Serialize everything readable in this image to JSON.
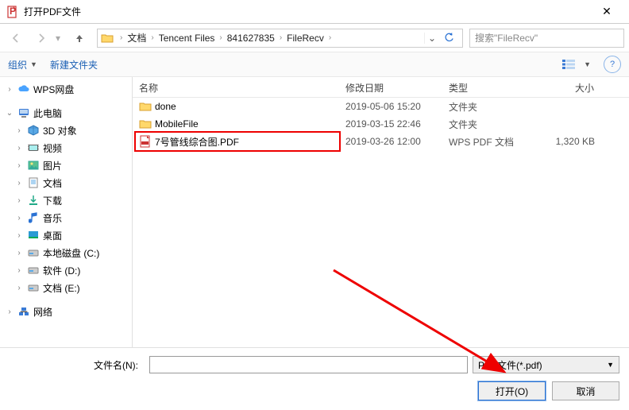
{
  "title": "打开PDF文件",
  "breadcrumbs": [
    "文档",
    "Tencent Files",
    "841627835",
    "FileRecv"
  ],
  "search_placeholder": "搜索\"FileRecv\"",
  "toolbar": {
    "organize": "组织",
    "newfolder": "新建文件夹"
  },
  "sidebar": {
    "wps": "WPS网盘",
    "thispc": "此电脑",
    "objects3d": "3D 对象",
    "videos": "视频",
    "pictures": "图片",
    "documents": "文档",
    "downloads": "下载",
    "music": "音乐",
    "desktop": "桌面",
    "diskC": "本地磁盘 (C:)",
    "diskD": "软件 (D:)",
    "diskE": "文档 (E:)",
    "network": "网络"
  },
  "columns": {
    "name": "名称",
    "date": "修改日期",
    "type": "类型",
    "size": "大小"
  },
  "files": [
    {
      "name": "done",
      "date": "2019-05-06 15:20",
      "type": "文件夹",
      "size": ""
    },
    {
      "name": "MobileFile",
      "date": "2019-03-15 22:46",
      "type": "文件夹",
      "size": ""
    },
    {
      "name": "7号管线综合图.PDF",
      "date": "2019-03-26 12:00",
      "type": "WPS PDF 文档",
      "size": "1,320 KB"
    }
  ],
  "bottom": {
    "filename_label": "文件名(N):",
    "filter": "PDF文件(*.pdf)",
    "open": "打开(O)",
    "cancel": "取消"
  }
}
